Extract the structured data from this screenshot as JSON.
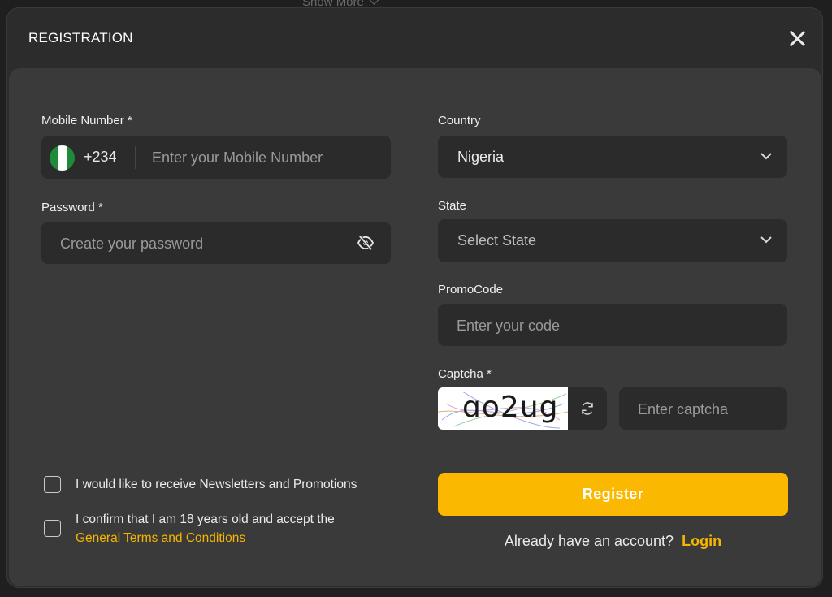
{
  "background": {
    "show_more_label": "Show More"
  },
  "modal": {
    "title": "REGISTRATION"
  },
  "form": {
    "mobile": {
      "label": "Mobile Number *",
      "dial_code": "+234",
      "placeholder": "Enter your Mobile Number",
      "flag_icon": "nigeria-flag-icon"
    },
    "password": {
      "label": "Password *",
      "placeholder": "Create your password",
      "toggle_icon": "eye-slash-icon"
    },
    "country": {
      "label": "Country",
      "selected": "Nigeria"
    },
    "state": {
      "label": "State",
      "selected": "Select State"
    },
    "promo": {
      "label": "PromoCode",
      "placeholder": "Enter your code"
    },
    "captcha": {
      "label": "Captcha *",
      "image_text": "ɑo2ug",
      "placeholder": "Enter captcha"
    },
    "newsletter_label": "I would like to receive Newsletters and Promotions",
    "age_label": "I confirm that I am 18 years old and accept the",
    "terms_link": "General Terms and Conditions",
    "register_label": "Register",
    "have_account": "Already have an account?",
    "login_label": "Login"
  },
  "colors": {
    "accent": "#fbb800",
    "panel": "#3a3a3a",
    "field": "#2b2b2b"
  }
}
